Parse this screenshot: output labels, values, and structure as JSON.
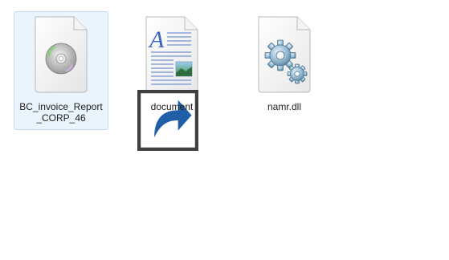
{
  "files": [
    {
      "name": "BC_invoice_Report_CORP_46",
      "icon": "disc-image-icon",
      "selected": true
    },
    {
      "name": "document",
      "icon": "document-icon",
      "shortcut": true
    },
    {
      "name": "namr.dll",
      "icon": "gears-icon"
    }
  ],
  "colors": {
    "selection_bg": "#eaf4fc",
    "selection_border": "#c4ddf2",
    "shortcut_arrow": "#1f5fa8"
  }
}
